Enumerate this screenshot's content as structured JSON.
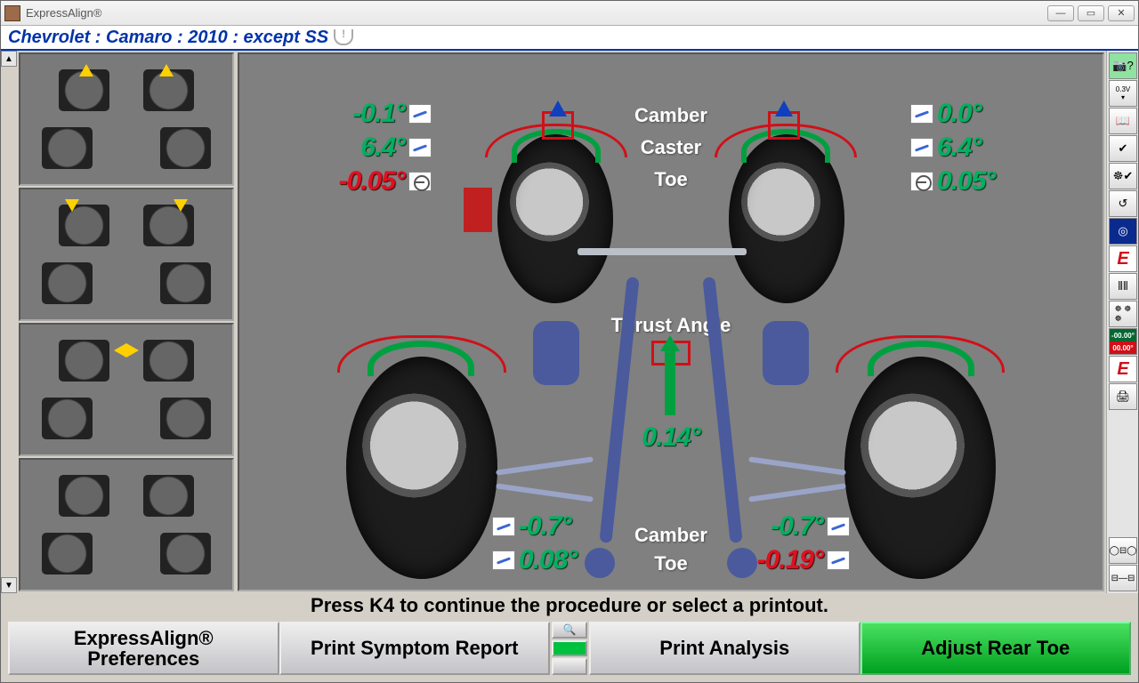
{
  "app": {
    "title": "ExpressAlign®"
  },
  "vehicle": {
    "desc": "Chevrolet : Camaro : 2010 : except SS"
  },
  "labels": {
    "camber": "Camber",
    "caster": "Caster",
    "toe": "Toe",
    "thrust": "Thrust Angle"
  },
  "front": {
    "left": {
      "camber": "-0.1°",
      "camber_status": "green",
      "caster": "6.4°",
      "caster_status": "green",
      "toe": "-0.05°",
      "toe_status": "red"
    },
    "right": {
      "camber": "0.0°",
      "camber_status": "green",
      "caster": "6.4°",
      "caster_status": "green",
      "toe": "0.05°",
      "toe_status": "green"
    }
  },
  "center": {
    "thrust": "0.14°",
    "thrust_status": "green"
  },
  "rear": {
    "left": {
      "camber": "-0.7°",
      "camber_status": "green",
      "toe": "0.08°",
      "toe_status": "green"
    },
    "right": {
      "camber": "-0.7°",
      "camber_status": "green",
      "toe": "-0.19°",
      "toe_status": "red"
    }
  },
  "hint": "Press K4 to continue the procedure or select a printout.",
  "buttons": {
    "b1": "ExpressAlign® Preferences",
    "b2": "Print Symptom Report",
    "b3": "Print Analysis",
    "b4": "Adjust Rear Toe"
  },
  "rightbar_split": {
    "top": "-00.00°",
    "bot": "00.00°"
  }
}
